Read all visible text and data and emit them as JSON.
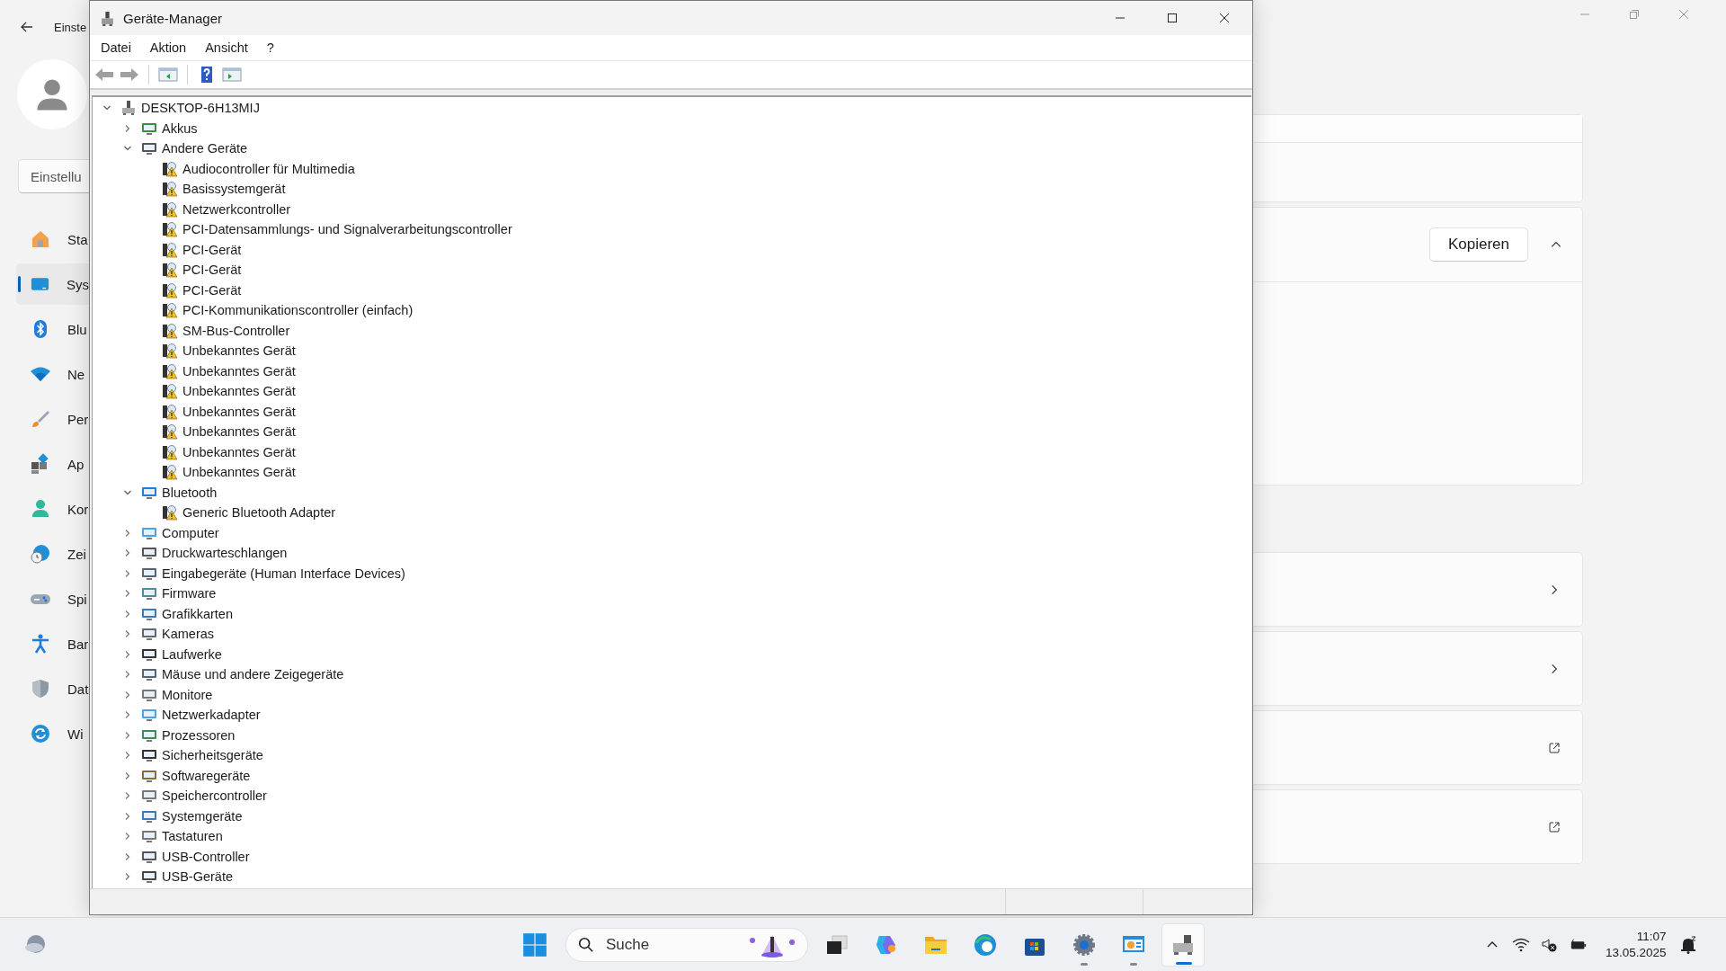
{
  "settings_window": {
    "header": "Einste",
    "search": {
      "placeholder": "Einstellu"
    },
    "nav": [
      {
        "label": "Sta",
        "selected": false
      },
      {
        "label": "Sys",
        "selected": true
      },
      {
        "label": "Blu",
        "selected": false
      },
      {
        "label": "Ne",
        "selected": false
      },
      {
        "label": "Per",
        "selected": false
      },
      {
        "label": "Ap",
        "selected": false
      },
      {
        "label": "Kor",
        "selected": false
      },
      {
        "label": "Zei",
        "selected": false
      },
      {
        "label": "Spi",
        "selected": false
      },
      {
        "label": "Bar",
        "selected": false
      },
      {
        "label": "Dat",
        "selected": false
      },
      {
        "label": "Wi",
        "selected": false
      }
    ],
    "copy_button": "Kopieren"
  },
  "device_manager": {
    "title": "Geräte-Manager",
    "menu": [
      "Datei",
      "Aktion",
      "Ansicht",
      "?"
    ],
    "tree": {
      "label": "DESKTOP-6H13MIJ",
      "expanded": true,
      "children": [
        {
          "label": "Akkus",
          "expanded": false
        },
        {
          "label": "Andere Geräte",
          "expanded": true,
          "children": [
            {
              "label": "Audiocontroller für Multimedia",
              "warning": true
            },
            {
              "label": "Basissystemgerät",
              "warning": true
            },
            {
              "label": "Netzwerkcontroller",
              "warning": true
            },
            {
              "label": "PCI-Datensammlungs- und Signalverarbeitungscontroller",
              "warning": true
            },
            {
              "label": "PCI-Gerät",
              "warning": true
            },
            {
              "label": "PCI-Gerät",
              "warning": true
            },
            {
              "label": "PCI-Gerät",
              "warning": true
            },
            {
              "label": "PCI-Kommunikationscontroller (einfach)",
              "warning": true
            },
            {
              "label": "SM-Bus-Controller",
              "warning": true
            },
            {
              "label": "Unbekanntes Gerät",
              "warning": true
            },
            {
              "label": "Unbekanntes Gerät",
              "warning": true
            },
            {
              "label": "Unbekanntes Gerät",
              "warning": true
            },
            {
              "label": "Unbekanntes Gerät",
              "warning": true
            },
            {
              "label": "Unbekanntes Gerät",
              "warning": true
            },
            {
              "label": "Unbekanntes Gerät",
              "warning": true
            },
            {
              "label": "Unbekanntes Gerät",
              "warning": true
            }
          ]
        },
        {
          "label": "Bluetooth",
          "expanded": true,
          "children": [
            {
              "label": "Generic Bluetooth Adapter",
              "warning": true
            }
          ]
        },
        {
          "label": "Computer",
          "expanded": false
        },
        {
          "label": "Druckwarteschlangen",
          "expanded": false
        },
        {
          "label": "Eingabegeräte (Human Interface Devices)",
          "expanded": false
        },
        {
          "label": "Firmware",
          "expanded": false
        },
        {
          "label": "Grafikkarten",
          "expanded": false
        },
        {
          "label": "Kameras",
          "expanded": false
        },
        {
          "label": "Laufwerke",
          "expanded": false
        },
        {
          "label": "Mäuse und andere Zeigegeräte",
          "expanded": false
        },
        {
          "label": "Monitore",
          "expanded": false
        },
        {
          "label": "Netzwerkadapter",
          "expanded": false
        },
        {
          "label": "Prozessoren",
          "expanded": false
        },
        {
          "label": "Sicherheitsgeräte",
          "expanded": false
        },
        {
          "label": "Softwaregeräte",
          "expanded": false
        },
        {
          "label": "Speichercontroller",
          "expanded": false
        },
        {
          "label": "Systemgeräte",
          "expanded": false
        },
        {
          "label": "Tastaturen",
          "expanded": false
        },
        {
          "label": "USB-Controller",
          "expanded": false
        },
        {
          "label": "USB-Geräte",
          "expanded": false
        }
      ]
    }
  },
  "taskbar": {
    "search": {
      "placeholder": "Suche"
    },
    "apps": [
      {
        "running": false,
        "selected": false
      },
      {
        "running": false,
        "selected": false
      },
      {
        "running": false,
        "selected": false
      },
      {
        "running": false,
        "selected": false
      },
      {
        "running": false,
        "selected": false
      },
      {
        "running": true,
        "selected": false
      },
      {
        "running": true,
        "selected": false
      },
      {
        "running": true,
        "selected": true
      }
    ],
    "clock": {
      "time": "11:07",
      "date": "13.05.2025"
    }
  }
}
